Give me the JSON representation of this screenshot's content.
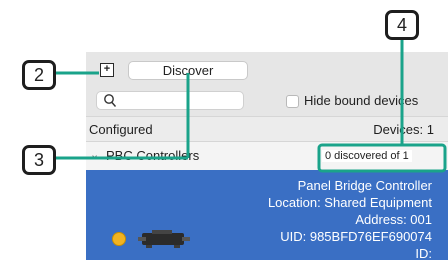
{
  "toolbar": {
    "add_icon": "plus-square-icon",
    "discover_label": "Discover"
  },
  "search": {
    "icon": "magnifier-icon",
    "placeholder": ""
  },
  "filter": {
    "hide_bound_label": "Hide bound devices",
    "checked": false
  },
  "configured": {
    "label": "Configured",
    "devices_label": "Devices: 1"
  },
  "group": {
    "label": "PBC Controllers",
    "discovered_label": "0 discovered of 1"
  },
  "device": {
    "name": "Panel Bridge Controller",
    "location": "Location: Shared Equipment",
    "address": "Address: 001",
    "uid": "UID: 985BFD76EF690074",
    "id_partial": "ID:",
    "status_color": "#f2b320"
  },
  "callouts": [
    {
      "number": "2",
      "target": "add-button"
    },
    {
      "number": "3",
      "target": "discover-button"
    },
    {
      "number": "4",
      "target": "discovered-count"
    }
  ],
  "colors": {
    "callout": "#1aa38a",
    "selection": "#3a6fc4"
  }
}
